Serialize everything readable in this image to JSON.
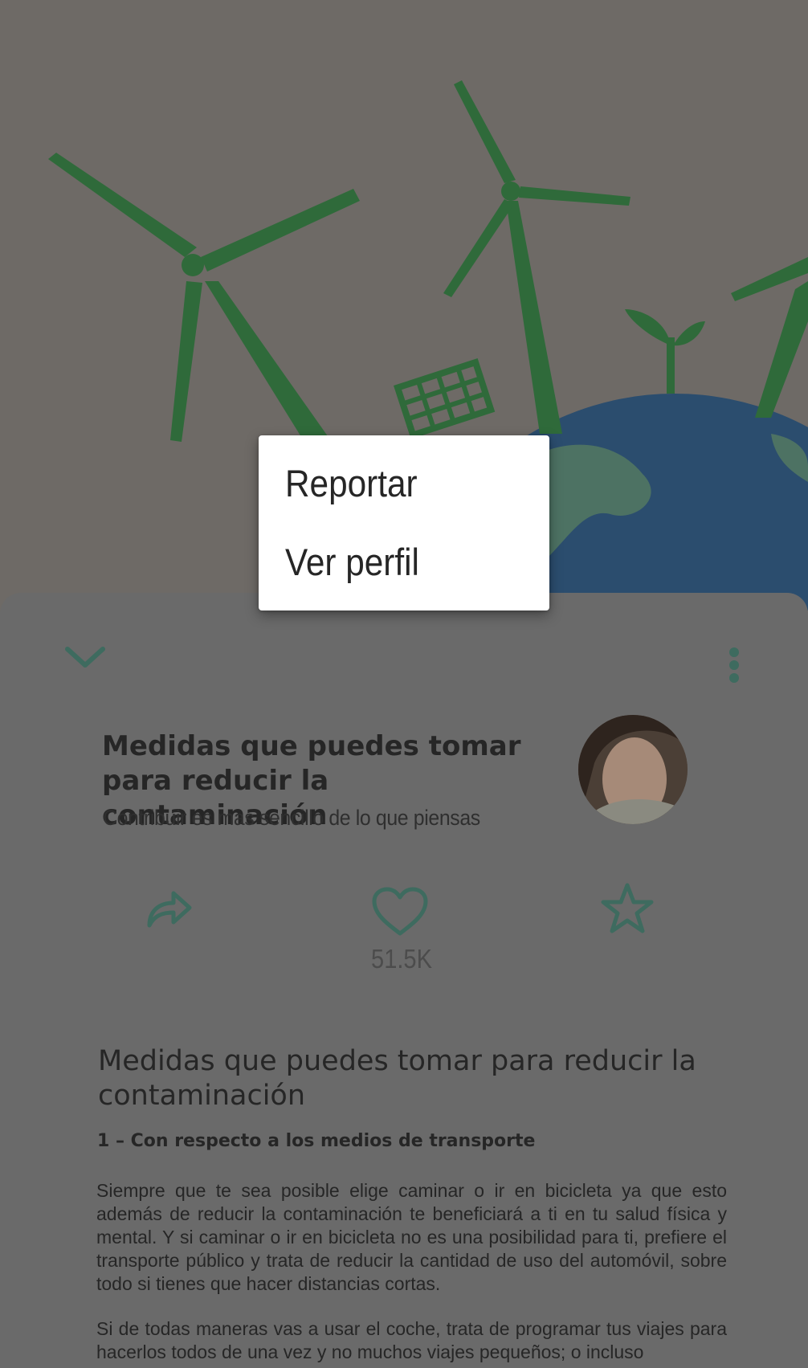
{
  "menu": {
    "items": [
      {
        "label": "Reportar"
      },
      {
        "label": "Ver perfil"
      }
    ]
  },
  "post": {
    "title": "Medidas que puedes tomar para reducir la contaminación",
    "subtitle": "Contribuir es mas sencillo de lo que piensas",
    "likes": "51.5K"
  },
  "article": {
    "heading": "Medidas que puedes tomar para reducir la contaminación",
    "section_heading": "1 – Con respecto a los medios de transporte",
    "paragraphs": [
      "Siempre que te sea posible elige caminar o ir en bicicleta ya que esto además de reducir la contaminación te beneficiará a ti en tu salud física y mental. Y si caminar o ir en bicicleta no es una posibilidad para ti, prefiere el transporte público y trata de reducir la cantidad de uso del automóvil, sobre todo si tienes que hacer distancias cortas.",
      "Si de todas maneras vas a usar el coche, trata de programar tus viajes para hacerlos todos de una vez y no muchos viajes pequeños; o incluso"
    ]
  },
  "icons": {
    "collapse": "chevron-down-icon",
    "overflow": "more-vert-icon",
    "share": "share-icon",
    "like": "heart-icon",
    "favorite": "star-icon"
  },
  "colors": {
    "accent": "#3e6b5f",
    "scrim_overlay": "#6a6a6a",
    "menu_bg": "#ffffff",
    "turbine_green": "#2f6a3a",
    "globe_blue": "#2b4d6e"
  }
}
